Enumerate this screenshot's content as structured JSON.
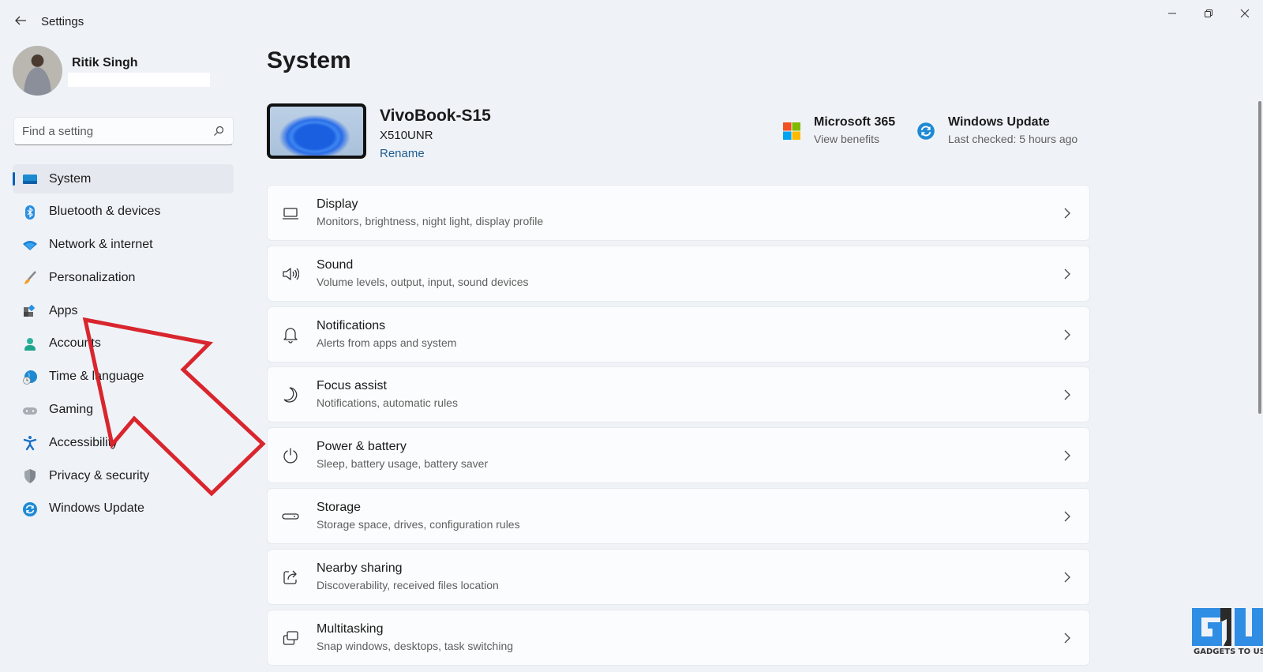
{
  "window": {
    "title": "Settings",
    "controls": {
      "minimize": "minimize",
      "maximize": "restore",
      "close": "close"
    }
  },
  "profile": {
    "name": "Ritik Singh"
  },
  "search": {
    "placeholder": "Find a setting",
    "value": ""
  },
  "sidebar": {
    "items": [
      {
        "label": "System",
        "icon": "system-icon",
        "active": true
      },
      {
        "label": "Bluetooth & devices",
        "icon": "bluetooth-icon"
      },
      {
        "label": "Network & internet",
        "icon": "wifi-icon"
      },
      {
        "label": "Personalization",
        "icon": "brush-icon"
      },
      {
        "label": "Apps",
        "icon": "apps-icon"
      },
      {
        "label": "Accounts",
        "icon": "account-icon"
      },
      {
        "label": "Time & language",
        "icon": "globe-clock-icon"
      },
      {
        "label": "Gaming",
        "icon": "gamepad-icon"
      },
      {
        "label": "Accessibility",
        "icon": "accessibility-icon"
      },
      {
        "label": "Privacy & security",
        "icon": "shield-icon"
      },
      {
        "label": "Windows Update",
        "icon": "update-icon"
      }
    ]
  },
  "main": {
    "title": "System",
    "device": {
      "name": "VivoBook-S15",
      "model": "X510UNR",
      "rename_label": "Rename"
    },
    "quick_links": [
      {
        "title": "Microsoft 365",
        "subtitle": "View benefits",
        "icon": "microsoft-logo-icon"
      },
      {
        "title": "Windows Update",
        "subtitle": "Last checked: 5 hours ago",
        "icon": "update-icon"
      }
    ],
    "cards": [
      {
        "title": "Display",
        "subtitle": "Monitors, brightness, night light, display profile",
        "icon": "laptop-icon"
      },
      {
        "title": "Sound",
        "subtitle": "Volume levels, output, input, sound devices",
        "icon": "speaker-icon"
      },
      {
        "title": "Notifications",
        "subtitle": "Alerts from apps and system",
        "icon": "bell-icon"
      },
      {
        "title": "Focus assist",
        "subtitle": "Notifications, automatic rules",
        "icon": "moon-icon"
      },
      {
        "title": "Power & battery",
        "subtitle": "Sleep, battery usage, battery saver",
        "icon": "power-icon"
      },
      {
        "title": "Storage",
        "subtitle": "Storage space, drives, configuration rules",
        "icon": "storage-icon"
      },
      {
        "title": "Nearby sharing",
        "subtitle": "Discoverability, received files location",
        "icon": "share-icon"
      },
      {
        "title": "Multitasking",
        "subtitle": "Snap windows, desktops, task switching",
        "icon": "multitask-icon"
      }
    ]
  },
  "annotation": {
    "type": "red-arrow",
    "points_to": "Apps",
    "color": "#d9262e"
  },
  "watermark": {
    "text": "GADGETS TO USE",
    "brand_color": "#2f8de4"
  },
  "colors": {
    "accent": "#005fb8",
    "link": "#1f5c8f",
    "background": "#eff3f8",
    "card": "#fbfcfd"
  }
}
